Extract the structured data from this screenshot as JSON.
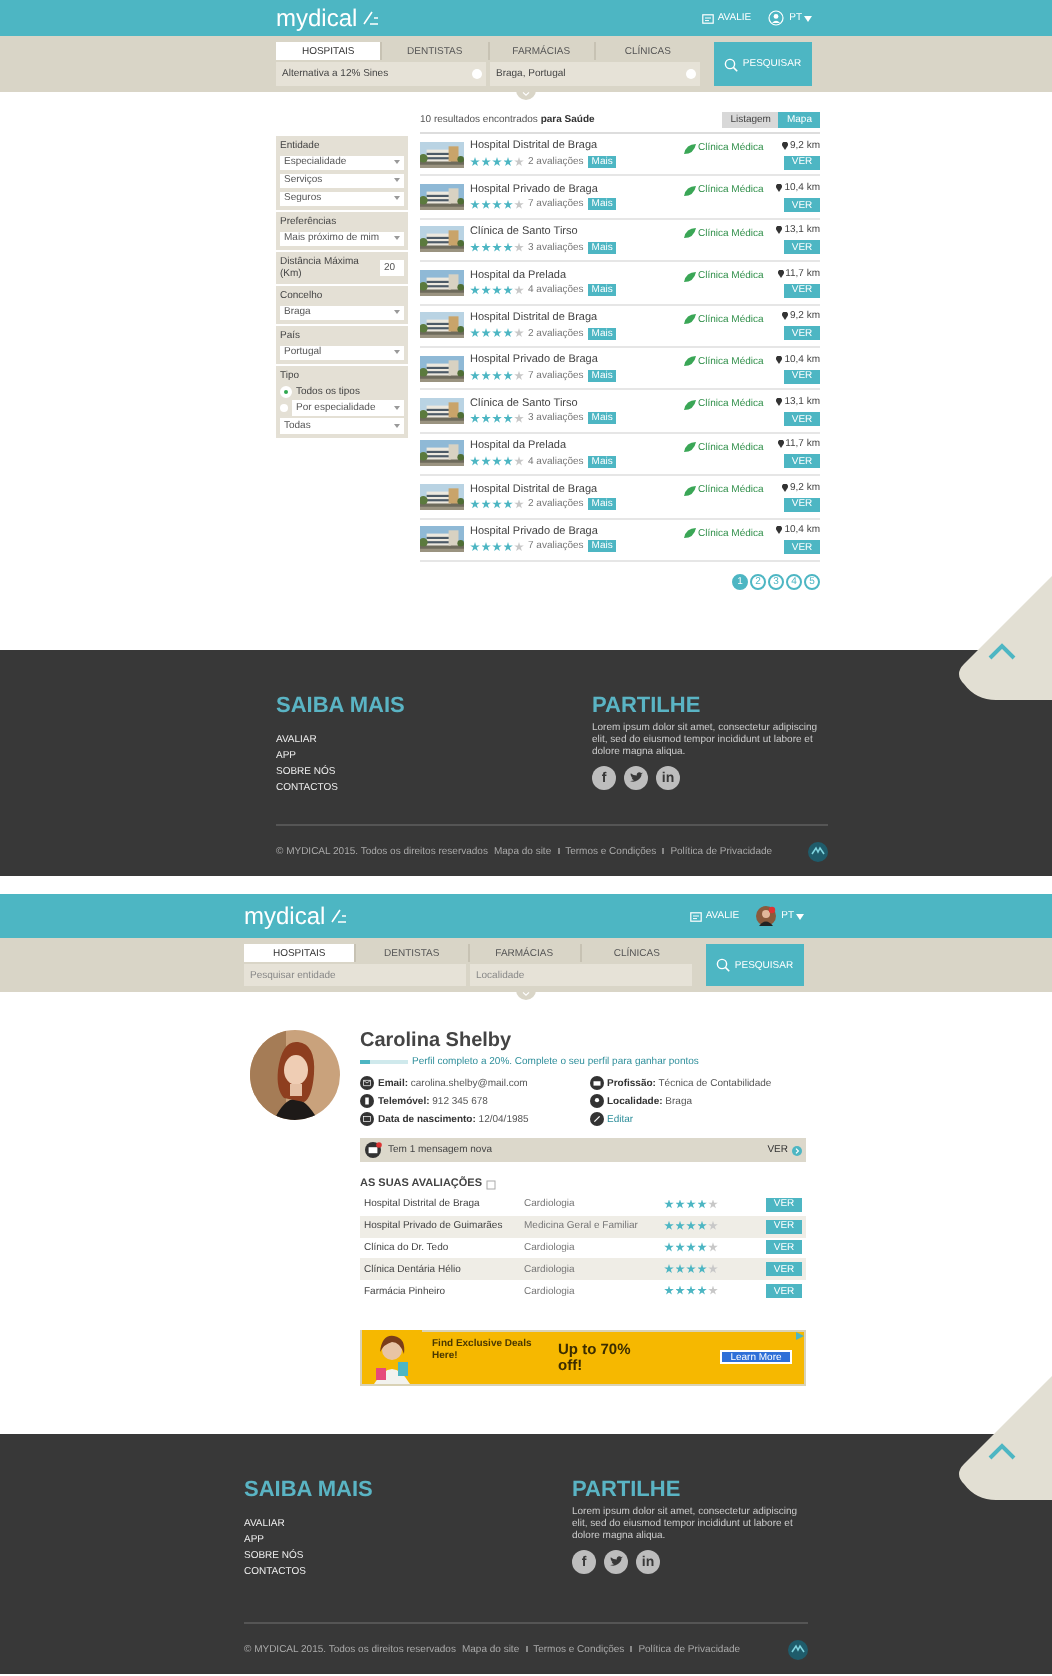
{
  "pages": [
    {
      "kind": "results",
      "header": {
        "logo": "mydical",
        "rate_link": "AVALIE",
        "account": {
          "kind": "guest"
        },
        "language": "PT",
        "tabs": [
          {
            "label": "HOSPITAIS",
            "selected": true
          },
          {
            "label": "DENTISTAS",
            "selected": false
          },
          {
            "label": "FARMÁCIAS",
            "selected": false
          },
          {
            "label": "CLÍNICAS",
            "selected": false
          }
        ],
        "fields": [
          {
            "value": "Alternativa a 12% Sines",
            "clearable": true
          },
          {
            "value": "Braga, Portugal",
            "clearable": true
          }
        ],
        "search_button": "PESQUISAR"
      },
      "results": {
        "summary": "10 resultados encontrados **para Saúde**",
        "view_toggle": [
          {
            "label": "Listagem",
            "selected": false
          },
          {
            "label": "Mapa",
            "selected": true
          }
        ],
        "filters": [
          {
            "label": "Entidade",
            "controls": [
              {
                "kind": "select",
                "value": "Especialidade"
              },
              {
                "kind": "select",
                "value": "Serviços"
              },
              {
                "kind": "select",
                "value": "Seguros"
              }
            ]
          },
          {
            "label": "Preferências",
            "controls": [
              {
                "kind": "select",
                "value": "Mais próximo de mim"
              }
            ]
          },
          {
            "controls": [
              {
                "kind": "number",
                "label": "Distância Máxima (Km)",
                "value": "20"
              }
            ]
          },
          {
            "label": "Concelho",
            "controls": [
              {
                "kind": "select",
                "value": "Braga"
              }
            ]
          },
          {
            "label": "País",
            "controls": [
              {
                "kind": "select",
                "value": "Portugal"
              }
            ]
          },
          {
            "label": "Tipo",
            "controls": [
              {
                "kind": "radio",
                "label": "Todos os tipos",
                "selected": true
              },
              {
                "kind": "radio_select",
                "value": "Por especialidade",
                "selected": false
              },
              {
                "kind": "select",
                "value": "Todas"
              }
            ]
          }
        ],
        "items": [
          {
            "name": "Hospital Distrital de Braga",
            "stars": 4,
            "reviews": "2 avaliações",
            "tag": "Mais",
            "partner": "Clínica Médica",
            "distance": "9,2 km",
            "button": "VER"
          },
          {
            "name": "Hospital Privado de Braga",
            "stars": 4,
            "reviews": "7 avaliações",
            "tag": "Mais",
            "partner": "Clínica Médica",
            "distance": "10,4 km",
            "button": "VER"
          },
          {
            "name": "Clínica de Santo Tirso",
            "stars": 4,
            "reviews": "3 avaliações",
            "tag": "Mais",
            "partner": "Clínica Médica",
            "distance": "13,1 km",
            "button": "VER"
          },
          {
            "name": "Hospital da Prelada",
            "stars": 4,
            "reviews": "4 avaliações",
            "tag": "Mais",
            "partner": "Clínica Médica",
            "distance": "11,7 km",
            "button": "VER"
          },
          {
            "name": "Hospital Distrital de Braga",
            "stars": 4,
            "reviews": "2 avaliações",
            "tag": "Mais",
            "partner": "Clínica Médica",
            "distance": "9,2 km",
            "button": "VER"
          },
          {
            "name": "Hospital Privado de Braga",
            "stars": 4,
            "reviews": "7 avaliações",
            "tag": "Mais",
            "partner": "Clínica Médica",
            "distance": "10,4 km",
            "button": "VER"
          },
          {
            "name": "Clínica de Santo Tirso",
            "stars": 4,
            "reviews": "3 avaliações",
            "tag": "Mais",
            "partner": "Clínica Médica",
            "distance": "13,1 km",
            "button": "VER"
          },
          {
            "name": "Hospital da Prelada",
            "stars": 4,
            "reviews": "4 avaliações",
            "tag": "Mais",
            "partner": "Clínica Médica",
            "distance": "11,7 km",
            "button": "VER"
          },
          {
            "name": "Hospital Distrital de Braga",
            "stars": 4,
            "reviews": "2 avaliações",
            "tag": "Mais",
            "partner": "Clínica Médica",
            "distance": "9,2 km",
            "button": "VER"
          },
          {
            "name": "Hospital Privado de Braga",
            "stars": 4,
            "reviews": "7 avaliações",
            "tag": "Mais",
            "partner": "Clínica Médica",
            "distance": "10,4 km",
            "button": "VER"
          }
        ],
        "pagination": [
          {
            "label": "1",
            "selected": true
          },
          {
            "label": "2",
            "selected": false
          },
          {
            "label": "3",
            "selected": false
          },
          {
            "label": "4",
            "selected": false
          },
          {
            "label": "5",
            "selected": false
          }
        ]
      },
      "footer": {
        "learn_title": "SAIBA MAIS",
        "links": [
          "AVALIAR",
          "APP",
          "SOBRE NÓS",
          "CONTACTOS"
        ],
        "share_title": "PARTILHE",
        "share_text": "Lorem ipsum dolor sit amet, consectetur adipiscing elit, sed do eiusmod tempor incididunt ut labore et dolore magna aliqua.",
        "social": [
          {
            "kind": "facebook",
            "glyph": "f"
          },
          {
            "kind": "twitter"
          },
          {
            "kind": "linkedin",
            "glyph": "in"
          }
        ],
        "copyright": "© MYDICAL 2015. Todos os direitos reservados",
        "legal_links": [
          "Mapa do site",
          "Termos e Condições",
          "Política de Privacidade"
        ]
      }
    },
    {
      "kind": "profile",
      "header": {
        "logo": "mydical",
        "rate_link": "AVALIE",
        "language": "PT",
        "tabs": [
          {
            "label": "HOSPITAIS",
            "selected": true
          },
          {
            "label": "DENTISTAS",
            "selected": false
          },
          {
            "label": "FARMÁCIAS",
            "selected": false
          },
          {
            "label": "CLÍNICAS",
            "selected": false
          }
        ],
        "fields": [
          {
            "placeholder": "Pesquisar entidade",
            "clearable": false
          },
          {
            "placeholder": "Localidade",
            "clearable": false
          }
        ],
        "search_button": "PESQUISAR"
      },
      "profile": {
        "name": "Carolina Shelby",
        "completion": {
          "level": 0.2,
          "text": "Perfil completo a 20%. Complete o seu perfil para ganhar pontos"
        },
        "details": [
          {
            "kind": "mail",
            "text": "**Email:** carolina.shelby@mail.com"
          },
          {
            "kind": "work",
            "text": "**Profissão:** Técnica de Contabilidade"
          },
          {
            "kind": "phone",
            "text": "**Telemóvel:** 912 345 678"
          },
          {
            "kind": "pin",
            "text": "**Localidade:** Braga"
          },
          {
            "kind": "calendar",
            "text": "**Data de nascimento:** 12/04/1985"
          },
          {
            "kind": "edit",
            "text": "Editar"
          }
        ],
        "message": {
          "text": "Tem 1 mensagem nova",
          "action": "VER"
        },
        "reviews_title": "AS SUAS AVALIAÇÕES",
        "reviews": [
          {
            "name": "Hospital Distrital de Braga",
            "service": "Cardiologia",
            "stars": 4,
            "button": "VER"
          },
          {
            "name": "Hospital Privado de Guimarães",
            "service": "Medicina Geral e Familiar",
            "stars": 4,
            "button": "VER"
          },
          {
            "name": "Clínica do Dr. Tedo",
            "service": "Cardiologia",
            "stars": 4,
            "button": "VER"
          },
          {
            "name": "Clínica Dentária Hélio",
            "service": "Cardiologia",
            "stars": 4,
            "button": "VER"
          },
          {
            "name": "Farmácia Pinheiro",
            "service": "Cardiologia",
            "stars": 4,
            "button": "VER"
          }
        ],
        "ad": {
          "headline": "Find Exclusive Deals Here!",
          "offer": "Up to 70% off!",
          "button": "Learn More"
        }
      },
      "footer": {
        "learn_title": "SAIBA MAIS",
        "links": [
          "AVALIAR",
          "APP",
          "SOBRE NÓS",
          "CONTACTOS"
        ],
        "share_title": "PARTILHE",
        "share_text": "Lorem ipsum dolor sit amet, consectetur adipiscing elit, sed do eiusmod tempor incididunt ut labore et dolore magna aliqua.",
        "social": [
          {
            "kind": "facebook",
            "glyph": "f"
          },
          {
            "kind": "twitter"
          },
          {
            "kind": "linkedin",
            "glyph": "in"
          }
        ],
        "copyright": "© MYDICAL 2015. Todos os direitos reservados",
        "legal_links": [
          "Mapa do site",
          "Termos e Condições",
          "Política de Privacidade"
        ]
      }
    }
  ]
}
